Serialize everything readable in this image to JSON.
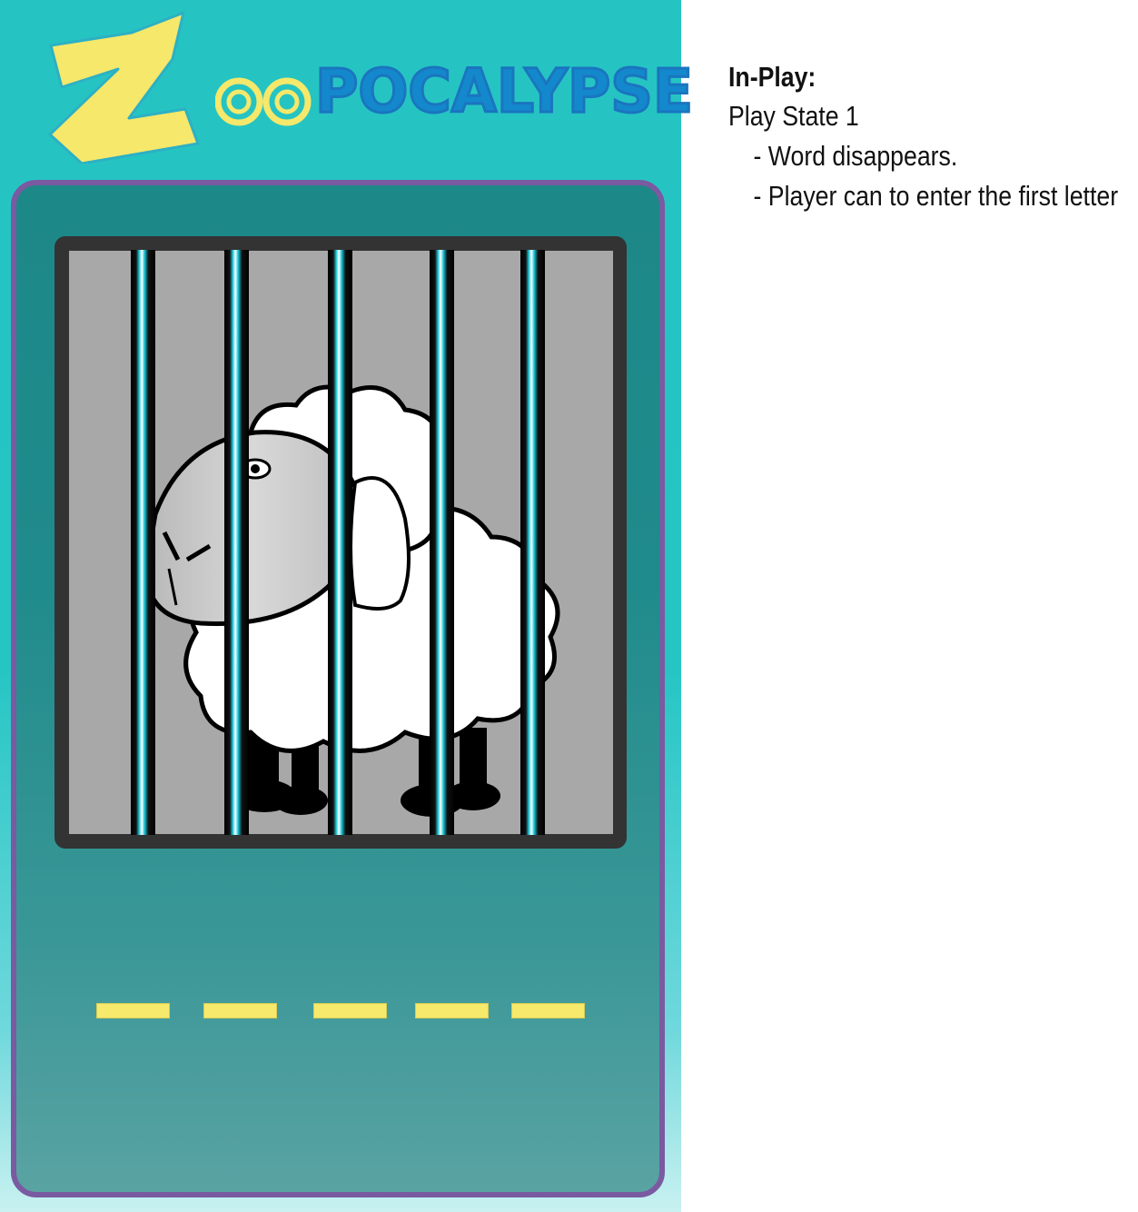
{
  "game": {
    "logo": {
      "first_letter": "Z",
      "oo": "OO",
      "rest": "POCALYPSE"
    },
    "word_slot_count": 5,
    "colors": {
      "background": "#25c4c3",
      "panel": "#1d8888",
      "panel_border": "#7a5aa0",
      "logo_z": "#f5e86a",
      "logo_text": "#1488cc",
      "slot": "#f6e96c"
    },
    "cage": {
      "animal": "sheep",
      "bar_count": 5
    }
  },
  "notes": {
    "heading": "In-Play:",
    "state_title": "Play State 1",
    "bullets": [
      "- Word disappears.",
      "- Player can to enter the first letter"
    ]
  }
}
